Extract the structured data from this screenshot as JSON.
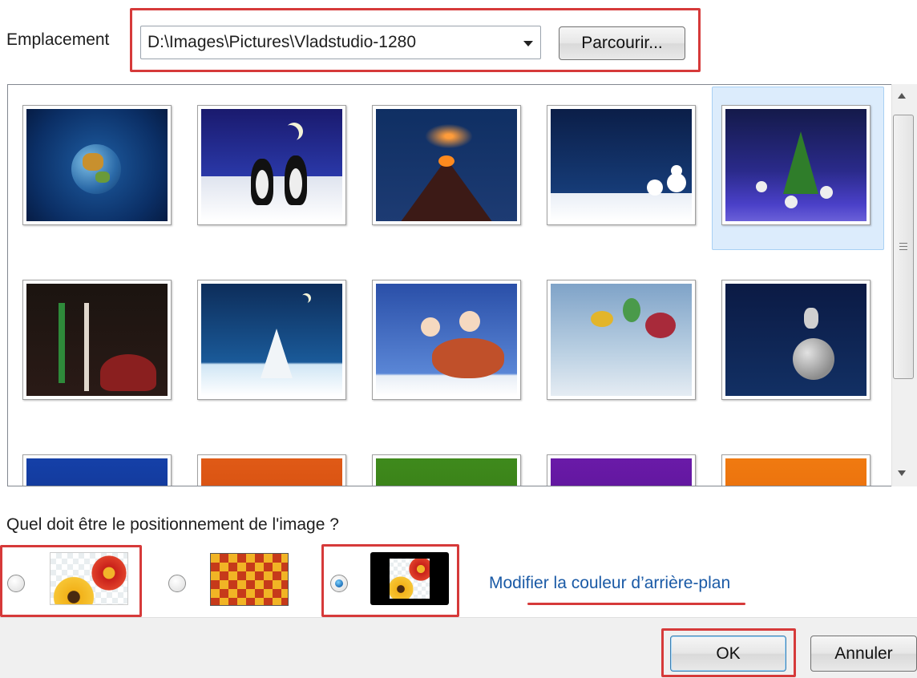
{
  "location": {
    "label": "Emplacement",
    "path": "D:\\Images\\Pictures\\Vladstudio-1280",
    "browse_label": "Parcourir..."
  },
  "thumbnails": [
    {
      "name": "globe-wallpaper"
    },
    {
      "name": "penguins-wallpaper"
    },
    {
      "name": "volcano-wallpaper"
    },
    {
      "name": "snowmen-night-wallpaper"
    },
    {
      "name": "christmas-tree-snowmen-wallpaper",
      "selected": true
    },
    {
      "name": "candles-gift-wallpaper"
    },
    {
      "name": "snowy-tree-wallpaper"
    },
    {
      "name": "children-horse-wallpaper"
    },
    {
      "name": "balloon-creatures-wallpaper"
    },
    {
      "name": "astronaut-planet-wallpaper"
    },
    {
      "name": "blue-moon-wallpaper"
    },
    {
      "name": "orange-wallpaper"
    },
    {
      "name": "green-wallpaper"
    },
    {
      "name": "purple-wallpaper"
    },
    {
      "name": "orange-gradient-wallpaper"
    }
  ],
  "position": {
    "label": "Quel doit être le positionnement de l'image ?",
    "options": [
      {
        "name": "fill",
        "selected": false
      },
      {
        "name": "tile",
        "selected": false
      },
      {
        "name": "center",
        "selected": true
      }
    ],
    "change_color_label": "Modifier la couleur d’arrière-plan"
  },
  "buttons": {
    "ok": "OK",
    "cancel": "Annuler"
  },
  "colors": {
    "highlight": "#d63a3a",
    "link": "#1a5aa6",
    "selection": "#dcecfc"
  }
}
